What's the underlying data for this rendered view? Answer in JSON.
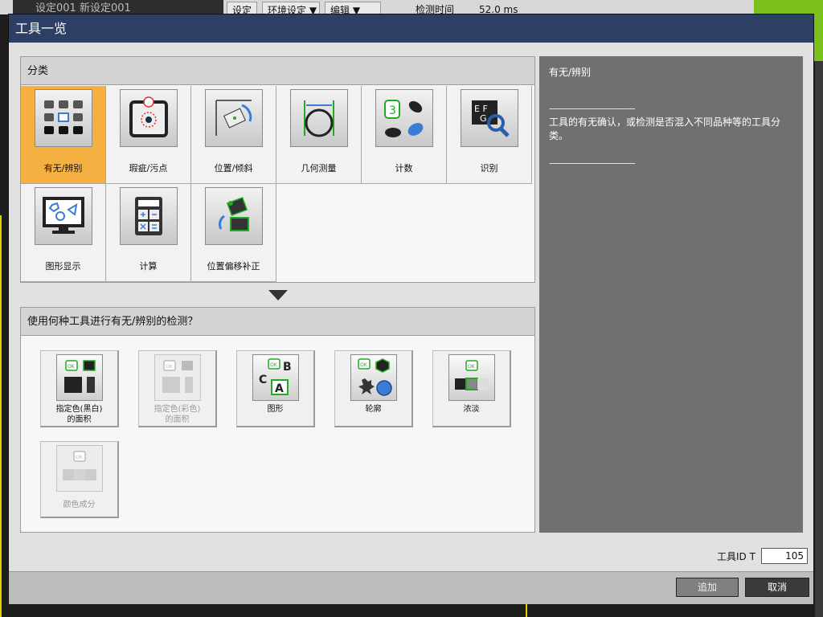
{
  "background": {
    "title_fragment": "设定001 新设定001",
    "menu_a": "设定",
    "menu_b": "环境设定 ▼",
    "menu_c": "编辑 ▼",
    "detect_time_label": "检测时间",
    "detect_time_value": "52.0 ms"
  },
  "dialog": {
    "title": "工具一览",
    "category_header": "分类",
    "categories": [
      {
        "label": "有无/辨别",
        "icon": "grid-squares-icon",
        "selected": true
      },
      {
        "label": "瑕疵/污点",
        "icon": "stain-target-icon",
        "selected": false
      },
      {
        "label": "位置/倾斜",
        "icon": "rotate-position-icon",
        "selected": false
      },
      {
        "label": "几何测量",
        "icon": "circle-measure-icon",
        "selected": false
      },
      {
        "label": "计数",
        "icon": "count-objects-icon",
        "selected": false
      },
      {
        "label": "识别",
        "icon": "ocr-magnifier-icon",
        "selected": false
      },
      {
        "label": "图形显示",
        "icon": "monitor-shapes-icon",
        "selected": false
      },
      {
        "label": "计算",
        "icon": "calculator-icon",
        "selected": false
      },
      {
        "label": "位置偏移补正",
        "icon": "offset-correction-icon",
        "selected": false
      }
    ],
    "tools_header": "使用何种工具进行有无/辨别的检测？",
    "tools": [
      {
        "label_line1": "指定色(黑白)",
        "label_line2": "的面积",
        "icon": "area-mono-icon",
        "enabled": true
      },
      {
        "label_line1": "指定色(彩色)",
        "label_line2": "的面积",
        "icon": "area-color-icon",
        "enabled": false
      },
      {
        "label_line1": "图形",
        "label_line2": "",
        "icon": "pattern-abc-icon",
        "enabled": true
      },
      {
        "label_line1": "轮廓",
        "label_line2": "",
        "icon": "contour-shapes-icon",
        "enabled": true
      },
      {
        "label_line1": "浓淡",
        "label_line2": "",
        "icon": "intensity-icon",
        "enabled": true
      },
      {
        "label_line1": "颜色成分",
        "label_line2": "",
        "icon": "color-component-icon",
        "enabled": false
      }
    ],
    "description": {
      "title": "有无/辨别",
      "divider": "--------------------------------",
      "text": "工具的有无确认，或检测是否混入不同品种等的工具分类。"
    },
    "tool_id_label": "工具ID T",
    "tool_id_value": "105",
    "add_button": "追加",
    "cancel_button": "取消"
  },
  "colors": {
    "titlebar": "#2e3f66",
    "selected_tile": "#f5b042",
    "description_bg": "#707070",
    "accent_green": "#7cc01e"
  }
}
